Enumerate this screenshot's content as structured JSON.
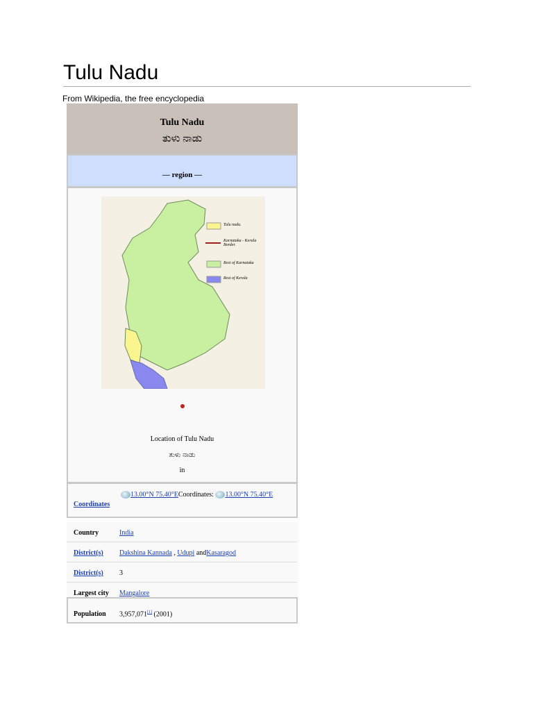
{
  "page": {
    "title": "Tulu Nadu",
    "subtitle": "From Wikipedia, the free encyclopedia"
  },
  "infobox": {
    "name": "Tulu Nadu",
    "native_name": "ತುಳು ನಾಡು",
    "type": "— region —",
    "map": {
      "legend": [
        "Tulu nadu.",
        "Karnataka - Kerala Border.",
        "Rest of Karnataka",
        "Rest of Kerala"
      ],
      "colors": {
        "tulu": "#fbf590",
        "border": "#a02020",
        "karnataka": "#c8f0a0",
        "kerala": "#8888ee"
      }
    },
    "location_caption": "Location of Tulu Nadu",
    "location_native": "ತುಳು ನಾಡು",
    "location_in": "in",
    "coordinates": {
      "label": "Coordinates",
      "value1": "13.00°N 75.40°E",
      "mid": "Coordinates:",
      "value2": "13.00°N 75.40°E"
    },
    "rows": [
      {
        "label": "Country",
        "value": "India"
      },
      {
        "label": "District(s)",
        "v1": "Dakshina Kannada",
        "sep1": " , ",
        "v2": "Udupi",
        "sep2": " and",
        "v3": "Kasaragod"
      },
      {
        "label": "District(s)",
        "value": "3"
      },
      {
        "label": "Largest city",
        "value": "Mangalore"
      }
    ],
    "population": {
      "label": "Population",
      "value": "3,957,071",
      "ref": "[1]",
      "year": "(2001)"
    }
  }
}
